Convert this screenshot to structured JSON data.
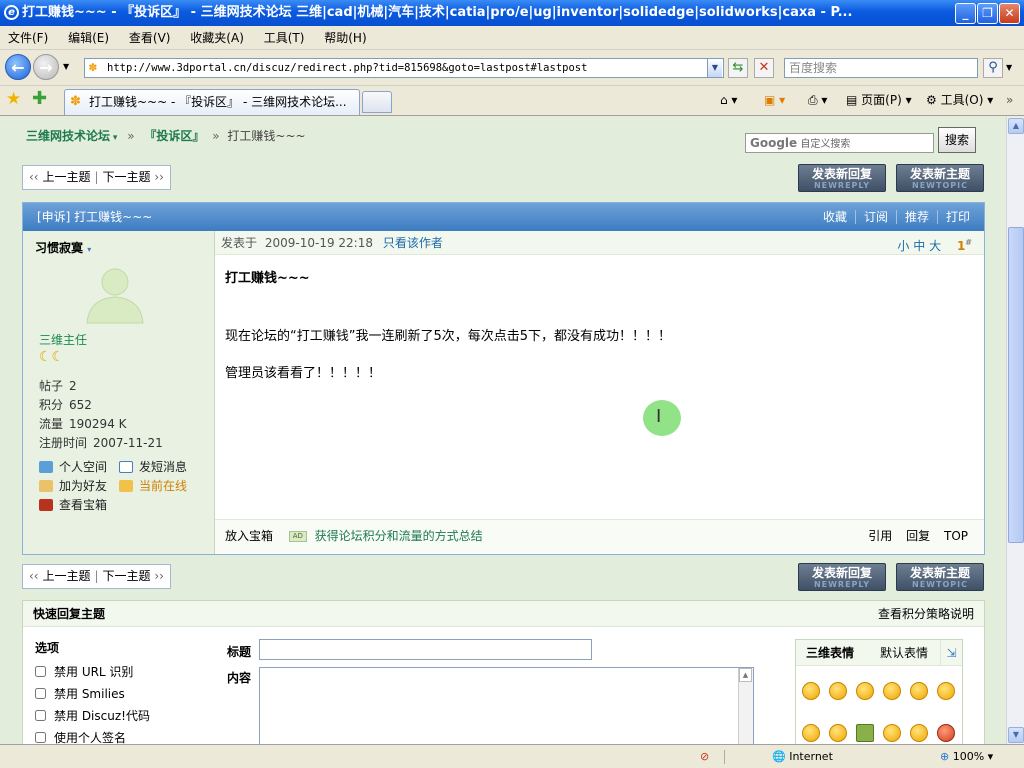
{
  "window": {
    "title": "打工赚钱~~~ - 『投诉区』 - 三维网技术论坛 三维|cad|机械|汽车|技术|catia|pro/e|ug|inventor|solidedge|solidworks|caxa - P..."
  },
  "menu": [
    "文件(F)",
    "编辑(E)",
    "查看(V)",
    "收藏夹(A)",
    "工具(T)",
    "帮助(H)"
  ],
  "browser": {
    "url": "http://www.3dportal.cn/discuz/redirect.php?tid=815698&goto=lastpost#lastpost",
    "search_placeholder": "百度搜索",
    "tab_title": "打工赚钱~~~ - 『投诉区』 - 三维网技术论坛...",
    "toolbar": {
      "page": "页面(P)",
      "tools": "工具(O)"
    }
  },
  "breadcrumb": {
    "forum": "三维网技术论坛",
    "section": "『投诉区』",
    "current": "打工赚钱~~~",
    "sep": "»"
  },
  "google": {
    "logo": "Google",
    "placeholder": "自定义搜索",
    "button": "搜索"
  },
  "pager": {
    "prev": "上一主题",
    "next": "下一主题"
  },
  "buttons": {
    "reply": "发表新回复",
    "reply_en": "NEWREPLY",
    "topic": "发表新主题",
    "topic_en": "NEWTOPIC"
  },
  "thread": {
    "title": "[申诉] 打工赚钱~~~",
    "ops": [
      "收藏",
      "订阅",
      "推荐",
      "打印"
    ]
  },
  "author": {
    "name": "习惯寂寞",
    "rank": "三维主任",
    "stats": [
      {
        "label": "帖子",
        "value": "2"
      },
      {
        "label": "积分",
        "value": "652"
      },
      {
        "label": "流量",
        "value": "190294 K"
      },
      {
        "label": "注册时间",
        "value": "2007-11-21"
      }
    ],
    "links": {
      "space": "个人空间",
      "pm": "发短消息",
      "friend": "加为好友",
      "online": "当前在线",
      "box": "查看宝箱"
    }
  },
  "post": {
    "posted_label": "发表于",
    "time": "2009-10-19 22:18",
    "only_author": "只看该作者",
    "font_sizes": [
      "小",
      "中",
      "大"
    ],
    "floor": "1",
    "floor_sup": "#",
    "title": "打工赚钱~~~",
    "line1": "现在论坛的“打工赚钱”我一连刷新了5次，每次点击5下，都没有成功！！！！",
    "line2": "管理员该看看了！！！！！",
    "footer": {
      "box": "放入宝箱",
      "ad": "AD",
      "ad_link": "获得论坛积分和流量的方式总结",
      "quote": "引用",
      "reply": "回复",
      "top": "TOP"
    }
  },
  "quick": {
    "title": "快速回复主题",
    "policy": "查看积分策略说明",
    "options_title": "选项",
    "options": [
      "禁用 URL 识别",
      "禁用 Smilies",
      "禁用 Discuz!代码",
      "使用个人签名"
    ],
    "subject_label": "标题",
    "content_label": "内容",
    "smile_tabs": [
      "三维表情",
      "默认表情"
    ]
  },
  "status": {
    "zone": "Internet",
    "zoom": "100%"
  }
}
